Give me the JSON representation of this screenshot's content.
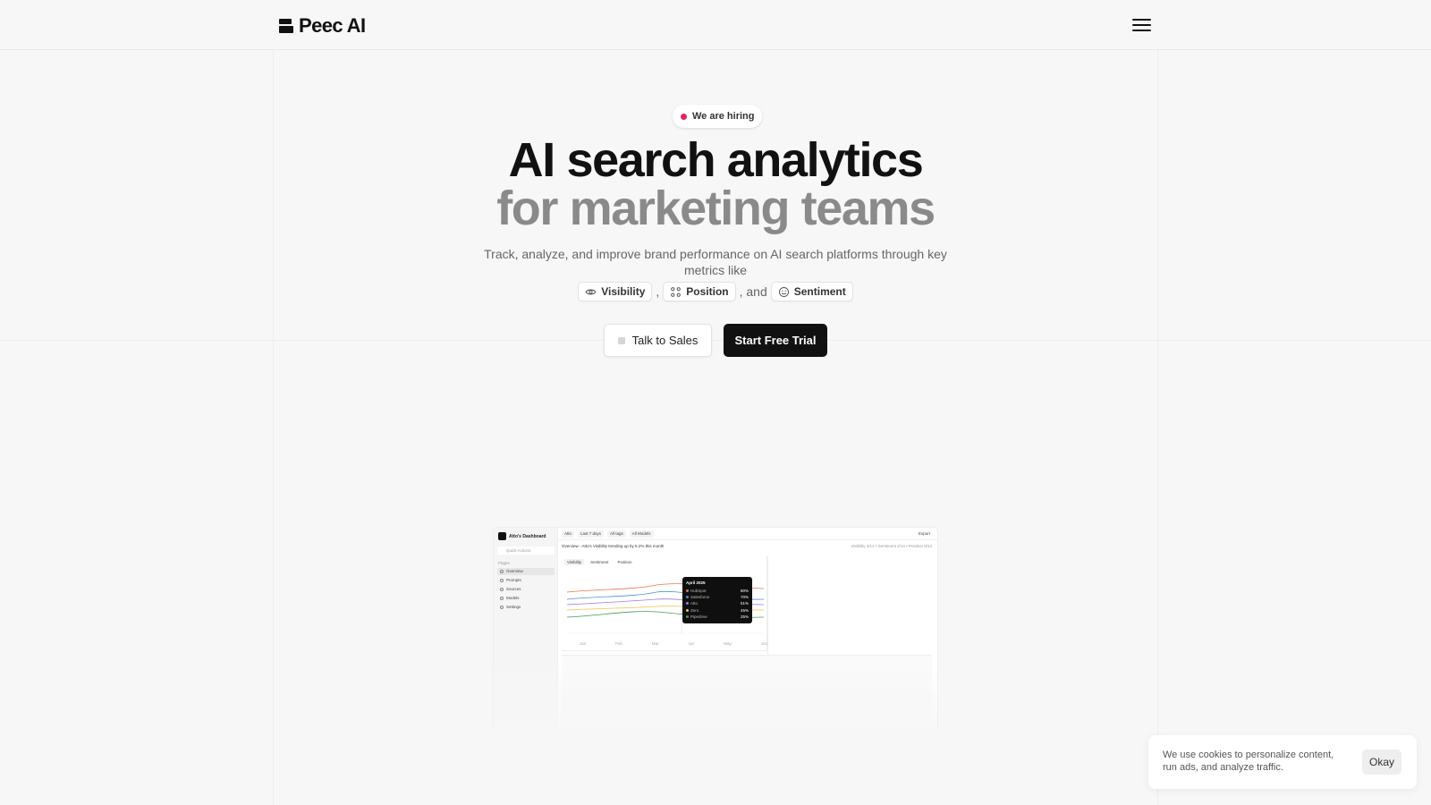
{
  "header": {
    "logo_text": "Peec AI",
    "menu_icon": "hamburger-menu-icon"
  },
  "hero": {
    "badge": "We are hiring",
    "badge_dot_color": "#e0245e",
    "headline_line1": "AI search analytics",
    "headline_line2": "for marketing teams",
    "subtext": "Track, analyze, and improve brand performance on AI search platforms through key metrics like",
    "metrics": [
      {
        "label": "Visibility",
        "icon": "eye-icon"
      },
      {
        "label": "Position",
        "icon": "position-icon"
      },
      {
        "label": "Sentiment",
        "icon": "smile-icon"
      }
    ],
    "sep_comma": ",",
    "sep_and": ", and",
    "cta_secondary": "Talk to Sales",
    "cta_primary": "Start Free Trial"
  },
  "dashboard": {
    "brand": "Atto's Dashboard",
    "search_placeholder": "Quick Actions",
    "pages_label": "Pages",
    "nav": [
      "Overview",
      "Prompts",
      "Sources",
      "Models",
      "Settings"
    ],
    "top_pills": [
      "Atto",
      "Last 7 days",
      "All tags",
      "All Models"
    ],
    "export_label": "Export",
    "crumb": "Overview - Atto's Visibility trending up by 5.2% this month",
    "stats": "Visibility 3/14  •  Sentiment 2/14  •  Position 5/14",
    "tabs": [
      "Visibility",
      "Sentiment",
      "Position"
    ],
    "months": [
      "Jan",
      "Feb",
      "Mar",
      "Apr",
      "May",
      "Jun"
    ],
    "tooltip": {
      "title": "April 2025",
      "rows": [
        {
          "name": "HubSpot",
          "value": "80%",
          "color": "#e8744f"
        },
        {
          "name": "Salesforce",
          "value": "70%",
          "color": "#4a8fe0"
        },
        {
          "name": "Atto",
          "value": "51%",
          "color": "#9b7ae0"
        },
        {
          "name": "Zero",
          "value": "45%",
          "color": "#e8c34f"
        },
        {
          "name": "Pipedrive",
          "value": "25%",
          "color": "#3f9a5a"
        }
      ]
    }
  },
  "cookie": {
    "text": "We use cookies to personalize content, run ads, and analyze traffic.",
    "button": "Okay"
  }
}
